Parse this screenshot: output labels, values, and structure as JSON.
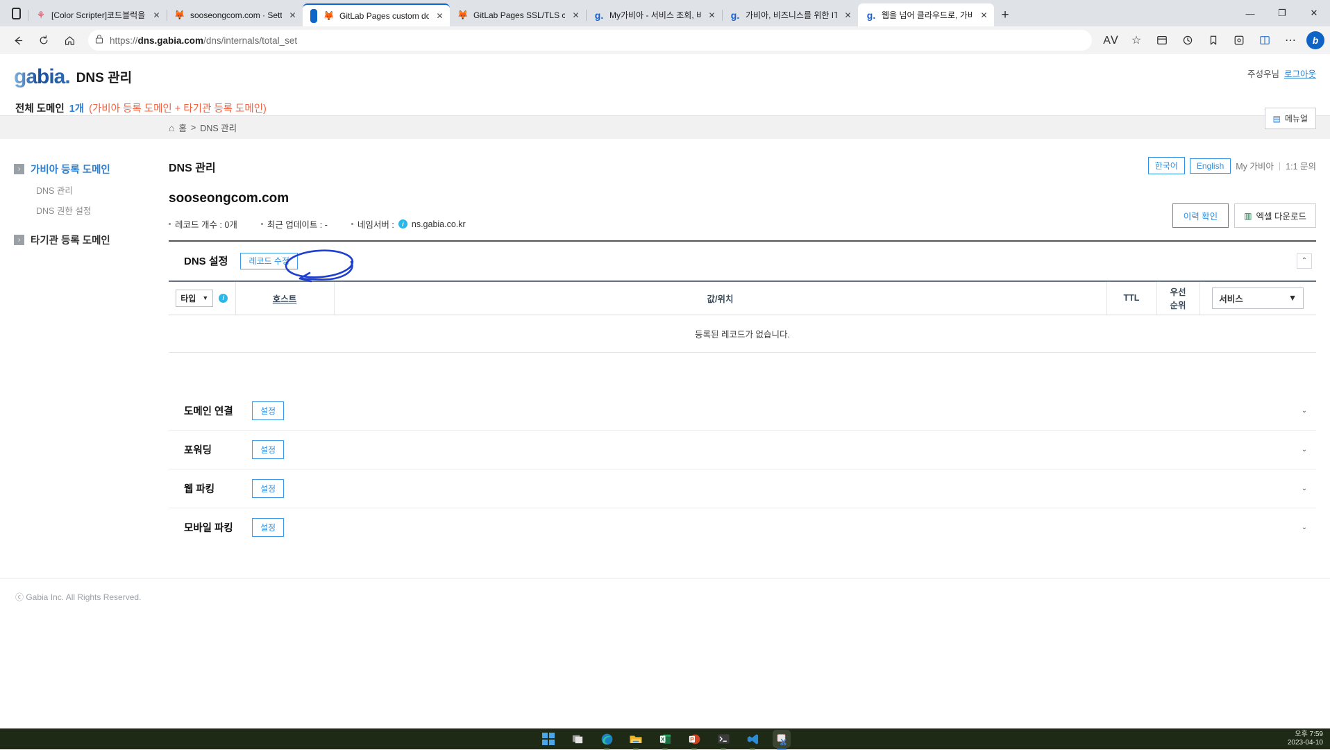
{
  "browser": {
    "tabs": [
      {
        "title": "[Color Scripter]코드블럭을 HTM",
        "favicon": "color-scripter-icon",
        "active": false
      },
      {
        "title": "sooseongcom.com · Settings · 구",
        "favicon": "firefox-icon",
        "active": false
      },
      {
        "title": "GitLab Pages custom domains",
        "favicon": "gitlab-icon",
        "active": false
      },
      {
        "title": "GitLab Pages SSL/TLS certificate",
        "favicon": "gitlab-icon",
        "active": false
      },
      {
        "title": "My가비아 - 서비스 조회, 비용 결",
        "favicon": "gabia-icon",
        "active": false
      },
      {
        "title": "가비아, 비즈니스를 위한 IT : 도메",
        "favicon": "gabia-icon",
        "active": false
      },
      {
        "title": "웹을 넘어 클라우드로, 가비아",
        "favicon": "gabia-icon",
        "active": true
      }
    ],
    "close_label": "✕",
    "newtab_label": "+",
    "window_controls": {
      "minimize": "—",
      "maximize": "❐",
      "close": "✕"
    },
    "toolbar": {
      "back": "←",
      "refresh": "⟳",
      "home": "⌂",
      "lock_icon": "lock-icon",
      "url_prefix": "https://",
      "url_host": "dns.gabia.com",
      "url_path": "/dns/internals/total_set",
      "read_aloud": "A͏ᐯ",
      "favorite": "☆",
      "collections": "⊞",
      "history": "⟲",
      "favorites_bar": "⛉",
      "browser_essentials": "◫",
      "split": "⛊",
      "settings": "⋯",
      "bing": "b"
    }
  },
  "page": {
    "logo": "gabia.",
    "title": "DNS 관리",
    "user_name": "주성우님",
    "logout": "로그아웃",
    "domain_summary": {
      "label": "전체 도메인",
      "count": "1개",
      "note": "(가비아 등록 도메인 + 타기관 등록 도메인)"
    },
    "lang": {
      "korean": "한국어",
      "english": "English",
      "my_gabia": "My 가비아",
      "divider": "|",
      "inquiry": "1:1 문의"
    },
    "breadcrumb": {
      "home": "홈",
      "sep": ">",
      "current": "DNS 관리"
    },
    "manual_button": "메뉴얼",
    "sidebar": {
      "groups": [
        {
          "label": "가비아 등록 도메인",
          "arrow": "›",
          "items": [
            {
              "label": "DNS 관리"
            },
            {
              "label": "DNS 권한 설정"
            }
          ]
        },
        {
          "label": "타기관 등록 도메인",
          "arrow": "›",
          "items": []
        }
      ]
    },
    "main": {
      "heading": "DNS 관리",
      "domain": "sooseongcom.com",
      "meta": {
        "record_count": "레코드 개수 : 0개",
        "last_update": "최근 업데이트 : -",
        "nameserver_label": "네임서버 :",
        "nameserver_value": "ns.gabia.co.kr"
      },
      "meta_buttons": {
        "history": "이력 확인",
        "excel": "엑셀 다운로드"
      },
      "dns_section": {
        "title": "DNS 설정",
        "edit_button": "레코드 수정",
        "collapse": "⌃"
      },
      "table": {
        "headers": {
          "type": "타입",
          "host": "호스트",
          "value": "값/위치",
          "ttl": "TTL",
          "priority": "우선\n순위",
          "service": "서비스"
        },
        "empty_message": "등록된 레코드가 없습니다."
      },
      "accordions": [
        {
          "title": "도메인 연결",
          "button": "설정",
          "chevron": "⌄"
        },
        {
          "title": "포워딩",
          "button": "설정",
          "chevron": "⌄"
        },
        {
          "title": "웹 파킹",
          "button": "설정",
          "chevron": "⌄"
        },
        {
          "title": "모바일 파킹",
          "button": "설정",
          "chevron": "⌄"
        }
      ]
    },
    "footer": "ⓒ Gabia Inc. All Rights Reserved."
  },
  "taskbar": {
    "icons": [
      "start-icon",
      "task-view-icon",
      "edge-icon",
      "file-explorer-icon",
      "excel-icon",
      "powerpoint-icon",
      "terminal-icon",
      "vscode-icon",
      "snipping-tool-icon"
    ],
    "time": "오후 7:59",
    "date": "2023-04-10"
  },
  "colors": {
    "accent_blue": "#2f8fe0",
    "link_blue": "#2f7fd1",
    "note_orange": "#f4603f",
    "annotation_blue": "#1f3fd0"
  }
}
